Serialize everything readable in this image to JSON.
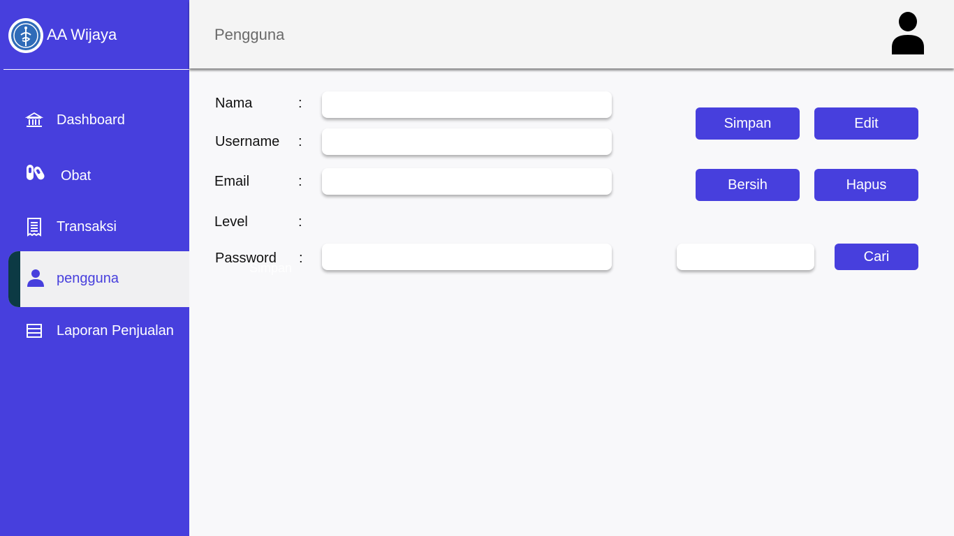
{
  "brand": {
    "name": "AA Wijaya",
    "logo_icon": "caduceus-logo-icon"
  },
  "header": {
    "title": "Pengguna",
    "avatar_icon": "user-avatar-icon"
  },
  "sidebar": {
    "items": [
      {
        "label": "Dashboard",
        "icon": "bank-icon",
        "active": false
      },
      {
        "label": "Obat",
        "icon": "pills-icon",
        "active": false
      },
      {
        "label": "Transaksi",
        "icon": "receipt-icon",
        "active": false
      },
      {
        "label": "pengguna",
        "icon": "user-icon",
        "active": true
      },
      {
        "label": "Laporan Penjualan",
        "icon": "report-icon",
        "active": false
      }
    ]
  },
  "form": {
    "fields": [
      {
        "label": "Nama",
        "value": ""
      },
      {
        "label": "Username",
        "value": ""
      },
      {
        "label": "Email",
        "value": ""
      },
      {
        "label": "Level",
        "value": ""
      },
      {
        "label": "Password",
        "value": ""
      }
    ],
    "colon": ":",
    "ghost_text": "Simpan"
  },
  "actions": {
    "simpan": "Simpan",
    "edit": "Edit",
    "bersih": "Bersih",
    "hapus": "Hapus",
    "cari": "Cari"
  },
  "search": {
    "value": ""
  },
  "colors": {
    "accent": "#473fdd",
    "active_bar": "#0c3a44",
    "header_bg": "#f4f4f4"
  }
}
